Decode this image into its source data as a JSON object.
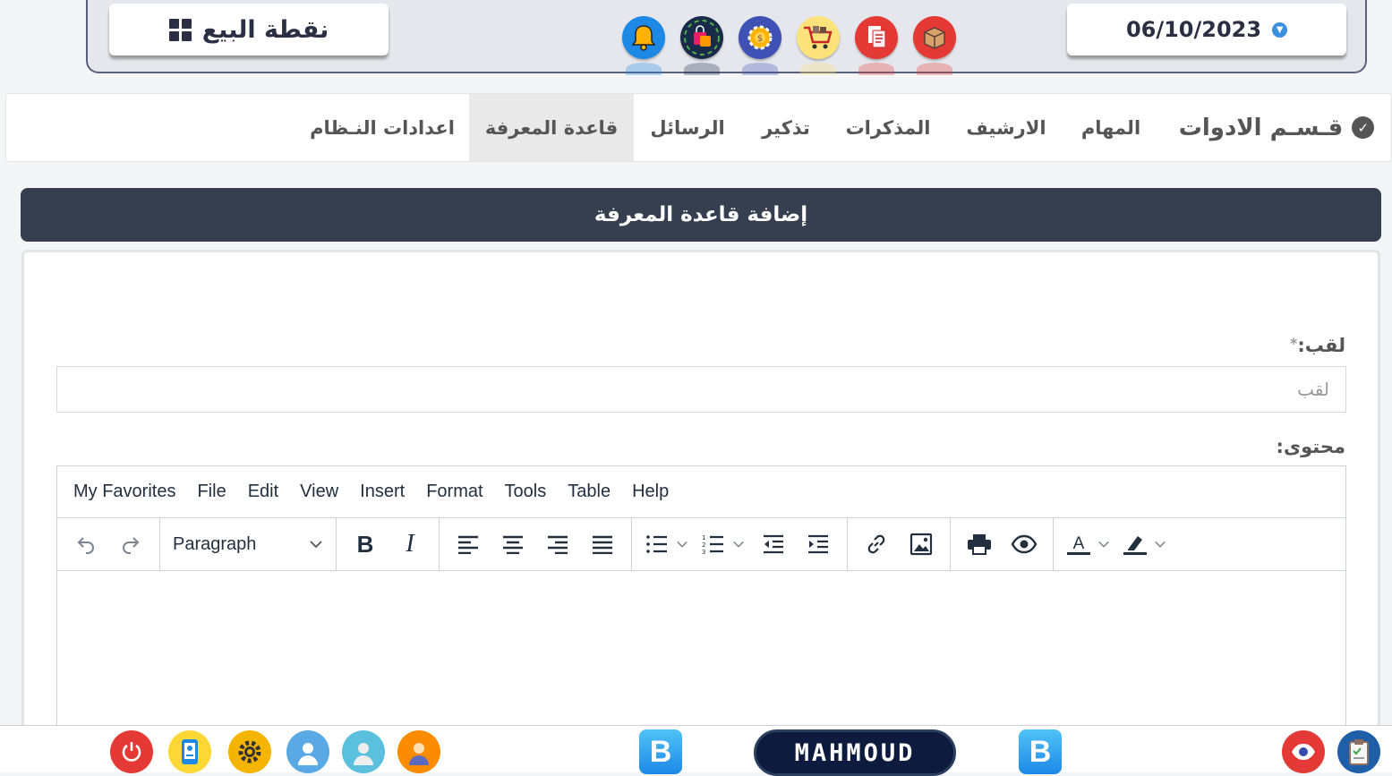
{
  "header": {
    "pos_label": "نقطة البيع",
    "date": "06/10/2023",
    "icons": [
      {
        "name": "box-icon",
        "color": "#e53935"
      },
      {
        "name": "documents-icon",
        "color": "#e53935"
      },
      {
        "name": "shopping-cart-icon",
        "color": "#fbe27a"
      },
      {
        "name": "settings-money-icon",
        "color": "#3f51b5"
      },
      {
        "name": "shopping-bags-icon",
        "color": "#1a2b4a"
      },
      {
        "name": "bell-icon",
        "color": "#1e88e5"
      }
    ]
  },
  "tabs": {
    "section_title": "قـسـم الادوات",
    "items": [
      "المهام",
      "الارشيف",
      "المذكرات",
      "تذكير",
      "الرسائل",
      "قاعدة المعرفة",
      "اعدادات النـظام"
    ],
    "active": "قاعدة المعرفة"
  },
  "panel": {
    "title": "إضافة قاعدة المعرفة",
    "title_label": "لقب:",
    "required_mark": "*",
    "title_placeholder": "لقب",
    "title_value": "",
    "content_label": "محتوى:"
  },
  "editor": {
    "menu": [
      "My Favorites",
      "File",
      "Edit",
      "View",
      "Insert",
      "Format",
      "Tools",
      "Table",
      "Help"
    ],
    "block_format": "Paragraph",
    "toolbar_icons": [
      "undo-icon",
      "redo-icon",
      "bold-icon",
      "italic-icon",
      "align-left-icon",
      "align-center-icon",
      "align-right-icon",
      "justify-icon",
      "bullet-list-icon",
      "numbered-list-icon",
      "outdent-icon",
      "indent-icon",
      "link-icon",
      "image-icon",
      "print-icon",
      "preview-icon",
      "text-color-icon",
      "highlight-icon"
    ]
  },
  "dock": {
    "user": "MAHMOUD",
    "app_letter_1": "B",
    "app_letter_2": "B",
    "icons": [
      "power-icon",
      "contacts-icon",
      "gear-icon",
      "user-icon",
      "user-icon",
      "user-icon",
      "eye-icon",
      "clipboard-icon"
    ]
  },
  "colors": {
    "panel_header": "#363f50",
    "active_tab": "#e9e9e9",
    "editor_text": "#222f3e"
  }
}
